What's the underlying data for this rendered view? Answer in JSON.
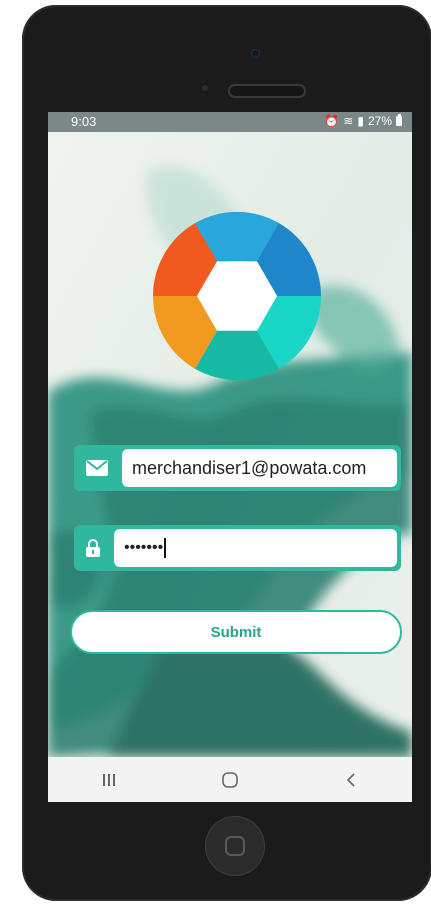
{
  "status_bar": {
    "time": "9:03",
    "battery": "27%"
  },
  "login": {
    "email_value": "merchandiser1@powata.com",
    "password_value": "•••••••",
    "submit_label": "Submit"
  },
  "nav": {
    "recents_icon": "recents-icon",
    "home_icon": "home-icon",
    "back_icon": "back-icon"
  },
  "colors": {
    "accent": "#2fb89d",
    "logo_segments": [
      "#27a7dc",
      "#1f86c9",
      "#19d6c6",
      "#16b9a6",
      "#f29a1d",
      "#f05a1e"
    ]
  }
}
